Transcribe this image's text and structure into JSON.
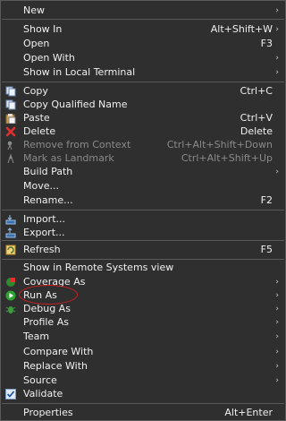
{
  "menu": {
    "new": {
      "label": "New"
    },
    "show_in": {
      "label": "Show In",
      "shortcut": "Alt+Shift+W"
    },
    "open": {
      "label": "Open",
      "shortcut": "F3"
    },
    "open_with": {
      "label": "Open With"
    },
    "show_terminal": {
      "label": "Show in Local Terminal"
    },
    "copy": {
      "label": "Copy",
      "shortcut": "Ctrl+C"
    },
    "copy_qualified": {
      "label": "Copy Qualified Name"
    },
    "paste": {
      "label": "Paste",
      "shortcut": "Ctrl+V"
    },
    "delete": {
      "label": "Delete",
      "shortcut": "Delete"
    },
    "remove_context": {
      "label": "Remove from Context",
      "shortcut": "Ctrl+Alt+Shift+Down"
    },
    "mark_landmark": {
      "label": "Mark as Landmark",
      "shortcut": "Ctrl+Alt+Shift+Up"
    },
    "build_path": {
      "label": "Build Path"
    },
    "move": {
      "label": "Move..."
    },
    "rename": {
      "label": "Rename...",
      "shortcut": "F2"
    },
    "import": {
      "label": "Import..."
    },
    "export": {
      "label": "Export..."
    },
    "refresh": {
      "label": "Refresh",
      "shortcut": "F5"
    },
    "show_remote": {
      "label": "Show in Remote Systems view"
    },
    "coverage_as": {
      "label": "Coverage As"
    },
    "run_as": {
      "label": "Run As"
    },
    "debug_as": {
      "label": "Debug As"
    },
    "profile_as": {
      "label": "Profile As"
    },
    "team": {
      "label": "Team"
    },
    "compare_with": {
      "label": "Compare With"
    },
    "replace_with": {
      "label": "Replace With"
    },
    "source": {
      "label": "Source"
    },
    "validate": {
      "label": "Validate"
    },
    "properties": {
      "label": "Properties",
      "shortcut": "Alt+Enter"
    }
  },
  "submenu_arrow": "›",
  "colors": {
    "annotation": "#d02020"
  }
}
